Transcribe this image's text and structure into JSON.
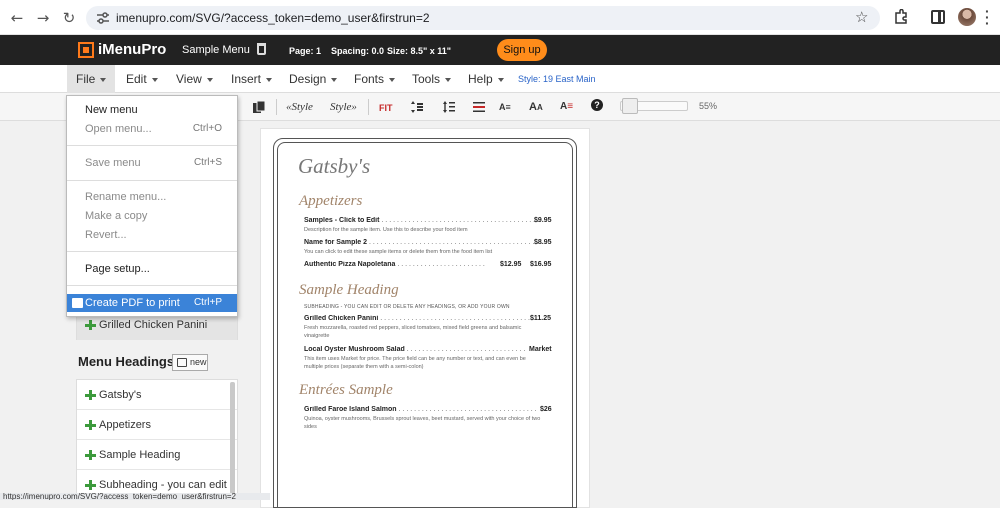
{
  "browser": {
    "url_host": "imenupro.com",
    "url_rest": "/SVG/?access_token=demo_user&firstrun=2",
    "status_url": "https://imenupro.com/SVG/?access_token=demo_user&firstrun=2"
  },
  "header": {
    "logo": "iMenuPro",
    "menu_name": "Sample Menu",
    "page": "Page: 1",
    "spacing": "Spacing: 0.0",
    "size": "Size: 8.5\" x 11\"",
    "signup": "Sign up"
  },
  "menubar": {
    "items": [
      "File",
      "Edit",
      "View",
      "Insert",
      "Design",
      "Fonts",
      "Tools",
      "Help"
    ],
    "style_link": "Style: 19 East Main"
  },
  "toolbar": {
    "style_prev": "«Style",
    "style_next": "Style»",
    "fit": "FIT",
    "zoom": "55%",
    "zoom_level": 0.55
  },
  "file_menu": {
    "items": [
      {
        "label": "New menu",
        "shortcut": "",
        "disabled": false
      },
      {
        "label": "Open menu...",
        "shortcut": "Ctrl+O",
        "disabled": true
      },
      {
        "label": "Save menu",
        "shortcut": "Ctrl+S",
        "disabled": true
      },
      {
        "label": "Rename menu...",
        "shortcut": "",
        "disabled": true
      },
      {
        "label": "Make a copy",
        "shortcut": "",
        "disabled": true
      },
      {
        "label": "Revert...",
        "shortcut": "",
        "disabled": true
      },
      {
        "label": "Page setup...",
        "shortcut": "",
        "disabled": false
      },
      {
        "label": "Create PDF to print",
        "shortcut": "Ctrl+P",
        "disabled": false
      }
    ]
  },
  "left_panel": {
    "items_visible": [
      "Grilled Chicken Panini"
    ],
    "headings_title": "Menu Headings",
    "new_btn": "new",
    "headings": [
      "Gatsby's",
      "Appetizers",
      "Sample Heading",
      "Subheading - you can edit ..."
    ]
  },
  "menu": {
    "title": "Gatsby's",
    "sections": [
      {
        "heading": "Appetizers",
        "subheading": "",
        "items": [
          {
            "name": "Samples - Click to Edit",
            "price": "$9.95",
            "price2": "",
            "desc": "Description for the sample item. Use this to describe your food item"
          },
          {
            "name": "Name for Sample 2",
            "price": "$8.95",
            "price2": "",
            "desc": "You can click to edit these sample items or delete them from the food item list"
          },
          {
            "name": "Authentic Pizza Napoletana",
            "price": "$12.95",
            "price2": "$16.95",
            "desc": ""
          }
        ]
      },
      {
        "heading": "Sample Heading",
        "subheading": "SUBHEADING - YOU CAN EDIT OR DELETE ANY HEADINGS, OR ADD YOUR OWN",
        "items": [
          {
            "name": "Grilled Chicken Panini",
            "price": "$11.25",
            "price2": "",
            "desc": "Fresh mozzarella, roasted red peppers, sliced tomatoes, mixed field greens and balsamic vinaigrette"
          },
          {
            "name": "Local Oyster Mushroom Salad",
            "price": "Market",
            "price2": "",
            "desc": "This item uses Market for price. The price field can be any number or text, and can even be multiple prices (separate them with a semi-colon)"
          }
        ]
      },
      {
        "heading": "Entrées Sample",
        "subheading": "",
        "items": [
          {
            "name": "Grilled Faroe Island Salmon",
            "price": "$26",
            "price2": "",
            "desc": "Quinoa, oyster mushrooms, Brussels sprout leaves, beet mustard, served with your choice of two sides"
          }
        ]
      }
    ]
  }
}
